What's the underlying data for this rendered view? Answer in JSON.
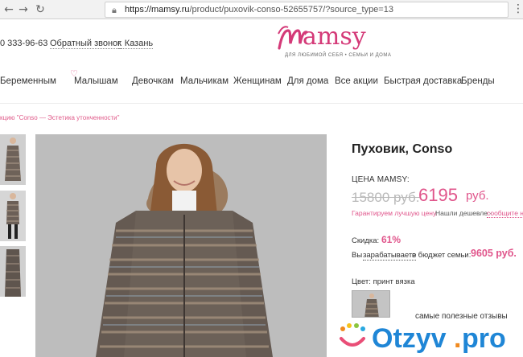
{
  "browser": {
    "url_host": "https://mamsy.ru",
    "url_path": "/product/puxovik-conso-52655757/?source_type=13",
    "icons": [
      "back-arrow-icon",
      "forward-arrow-icon",
      "reload-icon",
      "lock-icon",
      "menu-dots-icon"
    ]
  },
  "header": {
    "phone": "0 333-96-63",
    "callback": "Обратный звонок",
    "city": "г. Казань",
    "logo_word": "amsy",
    "logo_tagline": "ДЛЯ ЛЮБИМОЙ СЕБЯ • СЕМЬИ И ДОМА",
    "brand_color": "#d43a78"
  },
  "nav": {
    "items": [
      "Беременным",
      "Малышам",
      "Девочкам",
      "Мальчикам",
      "Женщинам",
      "Для дома",
      "Все акции",
      "Быстрая доставка",
      "Бренды"
    ]
  },
  "breadcrumb": "кцию \"Conso — Эстетика утонченности\"",
  "product": {
    "title": "Пуховик, Conso",
    "price_label": "ЦЕНА MAMSY:",
    "old_price": "15800 руб.",
    "new_price": "6195",
    "new_currency": "руб.",
    "guarantee": "Гарантируем лучшую цену.",
    "cheaper": "Нашли дешевле -",
    "report": "сообщите н",
    "discount_label": "Скидка:",
    "discount_value": "61%",
    "saved_prefix": "Вы",
    "saved_link": "зарабатываете",
    "saved_suffix": "в бюджет семьи:",
    "saved_value": "9605 руб.",
    "color_label": "Цвет: принт вязка",
    "accent_color": "#e0558b"
  },
  "watermark": {
    "tagline": "самые полезные отзывы"
  }
}
